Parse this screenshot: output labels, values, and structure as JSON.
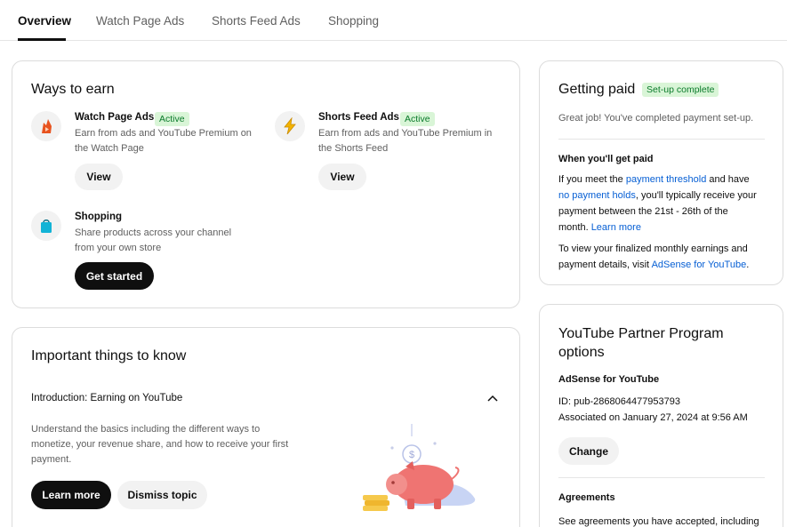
{
  "tabs": [
    {
      "label": "Overview"
    },
    {
      "label": "Watch Page Ads"
    },
    {
      "label": "Shorts Feed Ads"
    },
    {
      "label": "Shopping"
    }
  ],
  "ways_to_earn": {
    "title": "Ways to earn",
    "items": [
      {
        "title": "Watch Page Ads",
        "badge": "Active",
        "desc1": "Earn from ads and YouTube Premium on",
        "desc2": "the Watch Page",
        "button": "View"
      },
      {
        "title": "Shorts Feed Ads",
        "badge": "Active",
        "desc1": "Earn from ads and YouTube Premium in",
        "desc2": "the Shorts Feed",
        "button": "View"
      },
      {
        "title": "Shopping",
        "desc1": "Share products across your channel",
        "desc2": "from your own store",
        "button": "Get started"
      }
    ]
  },
  "important": {
    "title": "Important things to know",
    "topic_title": "Introduction: Earning on YouTube",
    "desc1": "Understand the basics including the different ways to",
    "desc2": "monetize, your revenue share, and how to receive your first",
    "desc3": "payment.",
    "learn_more": "Learn more",
    "dismiss": "Dismiss topic"
  },
  "getting_paid": {
    "title": "Getting paid",
    "badge": "Set-up complete",
    "status": "Great job! You've completed payment set-up.",
    "when_title": "When you'll get paid",
    "p1_a": "If you meet the ",
    "p1_link1": "payment threshold",
    "p1_b": " and have",
    "p1_link2": "no payment holds",
    "p1_c": ", you'll typically receive your",
    "p1_line3": "payment between the 21st - 26th of the",
    "p1_d": "month. ",
    "p1_link3": "Learn more",
    "p2_line1": "To view your finalized monthly earnings and",
    "p2_a": "payment details, visit ",
    "p2_link": "AdSense for YouTube",
    "p2_b": "."
  },
  "ypp": {
    "title_line1": "YouTube Partner Program",
    "title_line2": "options",
    "adsense_title": "AdSense for YouTube",
    "id_line": "ID: pub-2868064477953793",
    "assoc_line": "Associated on January 27, 2024 at 9:56 AM",
    "change": "Change",
    "agreements_title": "Agreements",
    "agreements_desc": "See agreements you have accepted, including"
  },
  "colors": {
    "accent": "#065fd4",
    "badge_bg": "#d9f5d7",
    "badge_text": "#0a7a2a",
    "watch_ads_icon": "#e8531f",
    "shorts_icon": "#f4b400",
    "shopping_icon": "#12b3d6"
  },
  "icons": {
    "watch_page_ads": "flame-play-icon",
    "shorts_feed_ads": "lightning-icon",
    "shopping": "shopping-bag-icon",
    "collapse": "chevron-up-icon",
    "illustration": "piggy-bank-illustration"
  }
}
